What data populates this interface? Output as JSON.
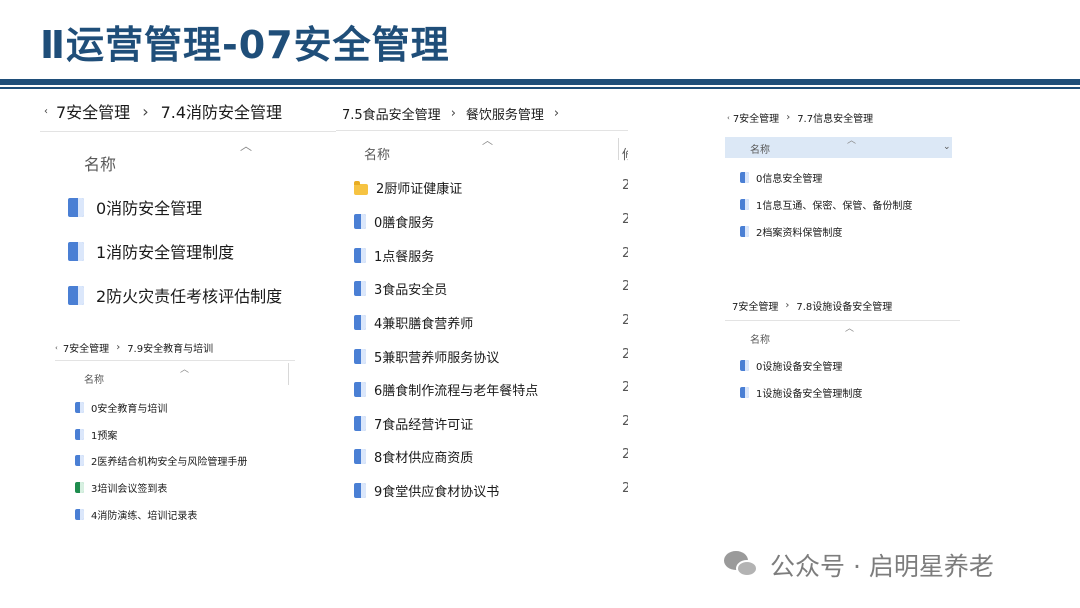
{
  "slide": {
    "title": "Ⅱ运营管理-07安全管理"
  },
  "panels": {
    "fire": {
      "crumb1": "7安全管理",
      "crumb2": "7.4消防安全管理",
      "col_name": "名称",
      "files": [
        {
          "name": "0消防安全管理",
          "type": "word"
        },
        {
          "name": "1消防安全管理制度",
          "type": "word"
        },
        {
          "name": "2防火灾责任考核评估制度",
          "type": "word"
        }
      ]
    },
    "food": {
      "crumb1": "7.5食品安全管理",
      "crumb2": "餐饮服务管理",
      "col_name": "名称",
      "col_next_trunc": "修",
      "files": [
        {
          "name": "2厨师证健康证",
          "type": "folder",
          "trunc": "2"
        },
        {
          "name": "0膳食服务",
          "type": "word",
          "trunc": "2"
        },
        {
          "name": "1点餐服务",
          "type": "word",
          "trunc": "2"
        },
        {
          "name": "3食品安全员",
          "type": "word",
          "trunc": "2"
        },
        {
          "name": "4兼职膳食营养师",
          "type": "word",
          "trunc": "2"
        },
        {
          "name": "5兼职营养师服务协议",
          "type": "word",
          "trunc": "2"
        },
        {
          "name": "6膳食制作流程与老年餐特点",
          "type": "word",
          "trunc": "2"
        },
        {
          "name": "7食品经营许可证",
          "type": "word",
          "trunc": "2"
        },
        {
          "name": "8食材供应商资质",
          "type": "word",
          "trunc": "2"
        },
        {
          "name": "9食堂供应食材协议书",
          "type": "word",
          "trunc": "2"
        }
      ]
    },
    "info": {
      "crumb1": "7安全管理",
      "crumb2": "7.7信息安全管理",
      "col_name": "名称",
      "files": [
        {
          "name": "0信息安全管理",
          "type": "word"
        },
        {
          "name": "1信息互通、保密、保管、备份制度",
          "type": "word"
        },
        {
          "name": "2档案资料保管制度",
          "type": "word"
        }
      ]
    },
    "equipment": {
      "crumb1": "7安全管理",
      "crumb2": "7.8设施设备安全管理",
      "col_name": "名称",
      "files": [
        {
          "name": "0设施设备安全管理",
          "type": "word"
        },
        {
          "name": "1设施设备安全管理制度",
          "type": "word"
        }
      ]
    },
    "training": {
      "crumb1": "7安全管理",
      "crumb2": "7.9安全教育与培训",
      "col_name": "名称",
      "files": [
        {
          "name": "0安全教育与培训",
          "type": "word"
        },
        {
          "name": "1预案",
          "type": "word"
        },
        {
          "name": "2医养结合机构安全与风险管理手册",
          "type": "word"
        },
        {
          "name": "3培训会议签到表",
          "type": "excel"
        },
        {
          "name": "4消防演练、培训记录表",
          "type": "word"
        }
      ]
    }
  },
  "watermark": {
    "text": "公众号 · 启明星养老",
    "icon": "wechat-icon"
  }
}
